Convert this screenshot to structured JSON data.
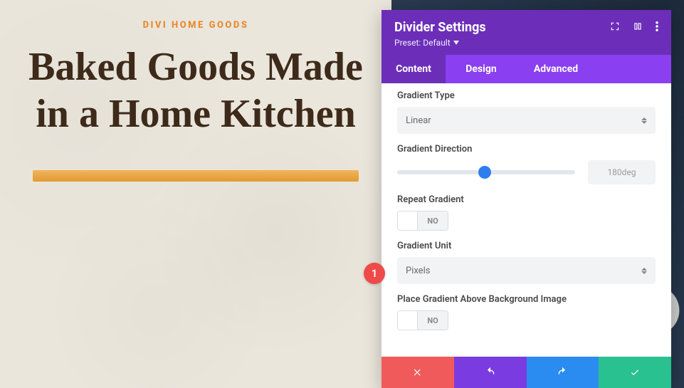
{
  "page": {
    "eyebrow": "DIVI HOME GOODS",
    "headline": "Baked Goods Made in a Home Kitchen"
  },
  "panel": {
    "title": "Divider Settings",
    "preset": "Preset: Default",
    "tabs": {
      "content": "Content",
      "design": "Design",
      "advanced": "Advanced"
    }
  },
  "fields": {
    "gradient_type": {
      "label": "Gradient Type",
      "value": "Linear"
    },
    "gradient_direction": {
      "label": "Gradient Direction",
      "value": "180deg"
    },
    "repeat_gradient": {
      "label": "Repeat Gradient",
      "value": "NO"
    },
    "gradient_unit": {
      "label": "Gradient Unit",
      "value": "Pixels"
    },
    "place_above": {
      "label": "Place Gradient Above Background Image",
      "value": "NO"
    }
  },
  "badge": {
    "step": "1"
  }
}
